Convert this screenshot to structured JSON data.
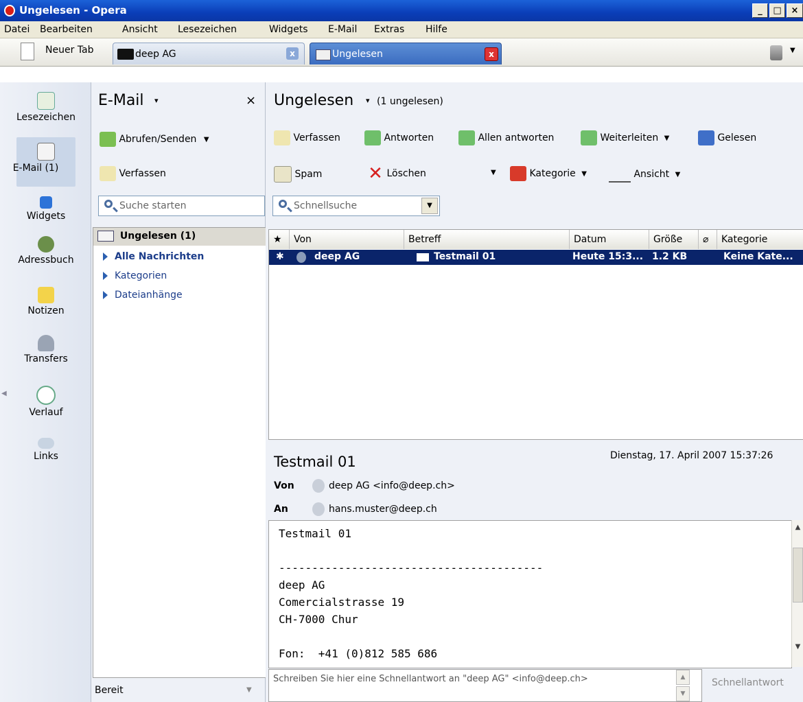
{
  "window": {
    "title": "Ungelesen - Opera",
    "minimize": "_",
    "maximize": "□",
    "close": "×"
  },
  "menubar": [
    "Datei",
    "Bearbeiten",
    "Ansicht",
    "Lesezeichen",
    "Widgets",
    "E-Mail",
    "Extras",
    "Hilfe"
  ],
  "tabs": {
    "new_tab": "Neuer Tab",
    "tab1": "deep AG",
    "tab2": "Ungelesen"
  },
  "panels": [
    {
      "label": "Lesezeichen",
      "icon": "bookmark-icon"
    },
    {
      "label": "E-Mail (1)",
      "icon": "mail-icon"
    },
    {
      "label": "Widgets",
      "icon": "widgets-icon"
    },
    {
      "label": "Adressbuch",
      "icon": "addressbook-icon"
    },
    {
      "label": "Notizen",
      "icon": "notes-icon"
    },
    {
      "label": "Transfers",
      "icon": "transfers-icon"
    },
    {
      "label": "Verlauf",
      "icon": "history-icon"
    },
    {
      "label": "Links",
      "icon": "links-icon"
    }
  ],
  "mailpanel": {
    "title": "E-Mail",
    "close": "×",
    "fetch_send": "Abrufen/Senden",
    "compose": "Verfassen",
    "search_placeholder": "Suche starten",
    "folders": [
      {
        "label": "Ungelesen (1)",
        "bold": true
      },
      {
        "label": "Alle Nachrichten",
        "bold": true
      },
      {
        "label": "Kategorien",
        "bold": false
      },
      {
        "label": "Dateianhänge",
        "bold": false
      }
    ],
    "status": "Bereit"
  },
  "view": {
    "title": "Ungelesen",
    "count": "(1 ungelesen)",
    "toolbar": {
      "compose": "Verfassen",
      "reply": "Antworten",
      "reply_all": "Allen antworten",
      "forward": "Weiterleiten",
      "read": "Gelesen",
      "spam": "Spam",
      "delete": "Löschen",
      "category": "Kategorie",
      "view": "Ansicht"
    },
    "quicksearch_placeholder": "Schnellsuche"
  },
  "list": {
    "columns": [
      "★",
      "Von",
      "Betreff",
      "Datum",
      "Größe",
      "Kategorie"
    ],
    "rows": [
      {
        "star": "✱",
        "from": "deep AG",
        "subject": "Testmail 01",
        "date": "Heute 15:3...",
        "size": "1.2 KB",
        "category": "Keine Kate..."
      }
    ]
  },
  "preview": {
    "subject": "Testmail 01",
    "date": "Dienstag, 17. April 2007 15:37:26",
    "from_label": "Von",
    "from": "deep AG <info@deep.ch>",
    "to_label": "An",
    "to": "hans.muster@deep.ch",
    "body": "Testmail 01\n\n----------------------------------------\ndeep AG\nComercialstrasse 19\nCH-7000 Chur\n\nFon:  +41 (0)812 585 686",
    "quickreply_placeholder": "Schreiben Sie hier eine Schnellantwort an \"deep AG\" <info@deep.ch>",
    "quickreply_button": "Schnellantwort"
  }
}
